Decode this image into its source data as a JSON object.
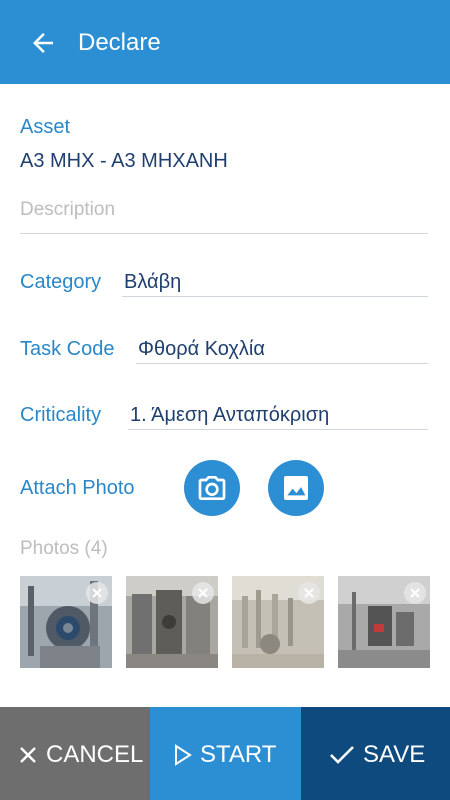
{
  "header": {
    "title": "Declare",
    "back_icon": "arrow-left-icon"
  },
  "form": {
    "asset_label": "Asset",
    "asset_value": "A3 MHX - A3 MHXANH",
    "description_placeholder": "Description",
    "category_label": "Category",
    "category_value": "Βλάβη",
    "task_code_label": "Task Code",
    "task_code_value": "Φθορά Κοχλία",
    "criticality_label": "Criticality",
    "criticality_value": "1. Άμεση Ανταπόκριση",
    "attach_photo_label": "Attach Photo",
    "camera_icon": "camera-icon",
    "gallery_icon": "image-gallery-icon",
    "photos_label": "Photos (4)"
  },
  "photos": [
    {
      "name": "industrial machinery photo 1"
    },
    {
      "name": "industrial machinery photo 2"
    },
    {
      "name": "industrial machinery photo 3"
    },
    {
      "name": "industrial machinery photo 4"
    }
  ],
  "actions": {
    "cancel_label": "CANCEL",
    "start_label": "START",
    "save_label": "SAVE"
  },
  "colors": {
    "primary": "#2d8fd3",
    "dark": "#0f4a7f",
    "cancel_gray": "#6e6e6e",
    "label_blue": "#2a87c7",
    "value_navy": "#1f3f6f"
  }
}
